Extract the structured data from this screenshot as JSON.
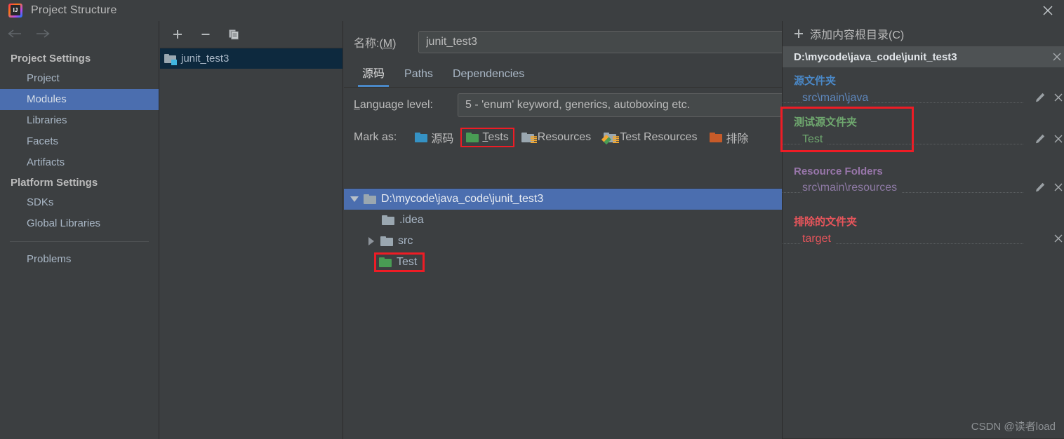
{
  "window": {
    "title": "Project Structure",
    "logo_icon": "intellij-idea-logo",
    "close_icon": "close-icon"
  },
  "sidebar": {
    "back_icon": "arrow-left-icon",
    "forward_icon": "arrow-right-icon",
    "groups": [
      {
        "label": "Project Settings",
        "items": [
          {
            "label": "Project",
            "selected": false
          },
          {
            "label": "Modules",
            "selected": true
          },
          {
            "label": "Libraries",
            "selected": false
          },
          {
            "label": "Facets",
            "selected": false
          },
          {
            "label": "Artifacts",
            "selected": false
          }
        ]
      },
      {
        "label": "Platform Settings",
        "items": [
          {
            "label": "SDKs",
            "selected": false
          },
          {
            "label": "Global Libraries",
            "selected": false
          }
        ]
      }
    ],
    "problems_label": "Problems"
  },
  "modules": {
    "toolbar": {
      "add_icon": "plus-icon",
      "remove_icon": "minus-icon",
      "copy_icon": "copy-icon"
    },
    "list": [
      {
        "label": "junit_test3",
        "selected": true,
        "icon": "module-folder-icon"
      }
    ]
  },
  "main": {
    "name_label": "名称:(M)",
    "name_mnemonic": "M",
    "name_value": "junit_test3",
    "name_placeholder": "",
    "tabs": [
      {
        "label": "源码",
        "active": true
      },
      {
        "label": "Paths",
        "active": false
      },
      {
        "label": "Dependencies",
        "active": false
      }
    ],
    "language_level_label": "Language level:",
    "language_level_value": "5 - 'enum' keyword, generics, autoboxing etc.",
    "mark_as_label": "Mark as:",
    "mark_as_options": [
      {
        "label": "源码",
        "icon": "folder-sources-icon",
        "color": "#3592c4",
        "style": "blue",
        "highlighted": false
      },
      {
        "label": "Tests",
        "icon": "folder-tests-icon",
        "color": "#499c54",
        "style": "green",
        "highlighted": true,
        "mnemonic": "T"
      },
      {
        "label": "Resources",
        "icon": "folder-resources-icon",
        "color": "#9aa7b0",
        "style": "gray-lines",
        "highlighted": false
      },
      {
        "label": "Test Resources",
        "icon": "folder-test-resources-icon",
        "color": "#499c54",
        "style": "diamond-lines",
        "highlighted": false
      },
      {
        "label": "排除",
        "icon": "folder-excluded-icon",
        "color": "#c75b29",
        "style": "orange",
        "highlighted": false
      }
    ]
  },
  "tree": {
    "rows": [
      {
        "label": "D:\\mycode\\java_code\\junit_test3",
        "indent": 0,
        "twisty": "down",
        "icon": "folder-gray-icon",
        "selected": true,
        "highlighted": false
      },
      {
        "label": ".idea",
        "indent": 1,
        "twisty": "none",
        "icon": "folder-gray-icon",
        "selected": false,
        "highlighted": false
      },
      {
        "label": "src",
        "indent": 1,
        "twisty": "right",
        "icon": "folder-gray-icon",
        "selected": false,
        "highlighted": false
      },
      {
        "label": "Test",
        "indent": 1,
        "twisty": "none",
        "icon": "folder-green-icon",
        "selected": false,
        "highlighted": true
      }
    ]
  },
  "details": {
    "add_content_root_label": "添加内容根目录(C)",
    "add_icon": "plus-icon",
    "root_path": "D:\\mycode\\java_code\\junit_test3",
    "root_remove_icon": "close-icon",
    "sections": [
      {
        "title": "源文件夹",
        "kind": "src",
        "color": "#4a88c7",
        "highlighted": false,
        "entries": [
          {
            "path": "src\\main\\java",
            "edit_icon": "pencil-icon",
            "remove_icon": "close-icon",
            "has_edit": true
          }
        ]
      },
      {
        "title": "测试源文件夹",
        "kind": "test",
        "color": "#6fa86f",
        "highlighted": true,
        "entries": [
          {
            "path": "Test",
            "edit_icon": "pencil-icon",
            "remove_icon": "close-icon",
            "has_edit": true
          }
        ]
      },
      {
        "title": "Resource Folders",
        "kind": "res",
        "color": "#9876aa",
        "highlighted": false,
        "entries": [
          {
            "path": "src\\main\\resources",
            "edit_icon": "pencil-icon",
            "remove_icon": "close-icon",
            "has_edit": true
          }
        ]
      },
      {
        "title": "排除的文件夹",
        "kind": "excl",
        "color": "#e8555b",
        "highlighted": false,
        "entries": [
          {
            "path": "target",
            "edit_icon": "pencil-icon",
            "remove_icon": "close-icon",
            "has_edit": false
          }
        ]
      }
    ]
  },
  "watermark": "CSDN @读者load",
  "theme": {
    "bg": "#3c3f41",
    "selection_blue": "#4b6eaf",
    "list_selection": "#0d293e",
    "accent_red_box": "#ee1c25",
    "tab_underline": "#4a88c7"
  }
}
